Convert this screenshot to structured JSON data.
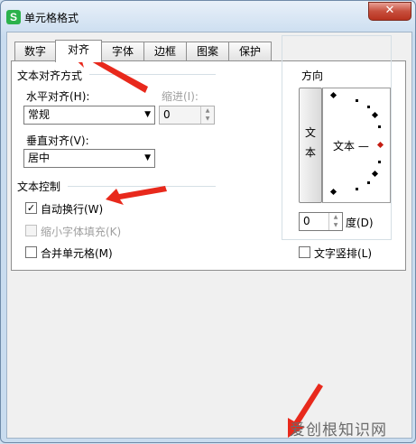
{
  "window": {
    "title": "单元格格式",
    "app_icon": "S",
    "close_glyph": "✕"
  },
  "tabs": [
    "数字",
    "对齐",
    "字体",
    "边框",
    "图案",
    "保护"
  ],
  "active_tab": "对齐",
  "alignment": {
    "group_title": "文本对齐方式",
    "horizontal_label": "水平对齐(H):",
    "horizontal_value": "常规",
    "indent_label": "缩进(I):",
    "indent_value": "0",
    "vertical_label": "垂直对齐(V):",
    "vertical_value": "居中"
  },
  "text_control": {
    "group_title": "文本控制",
    "wrap_text": {
      "label": "自动换行(W)",
      "checked": true,
      "enabled": true
    },
    "shrink_to_fit": {
      "label": "缩小字体填充(K)",
      "checked": false,
      "enabled": false
    },
    "merge_cells": {
      "label": "合并单元格(M)",
      "checked": false,
      "enabled": true
    }
  },
  "orientation": {
    "group_title": "方向",
    "vertical_text_chars": [
      "文",
      "本"
    ],
    "sample_text": "文本 —",
    "degrees_value": "0",
    "degrees_label": "度(D)",
    "vertical_checkbox_label": "文字竖排(L)"
  },
  "icons": {
    "dropdown": "▼",
    "spin_up": "▲",
    "spin_down": "▼",
    "check": "✓"
  },
  "colors": {
    "annotation_arrow": "#e8291c",
    "close_button": "#c74f3d",
    "app_icon": "#2bb24c"
  },
  "watermark": "爱创根知识网"
}
